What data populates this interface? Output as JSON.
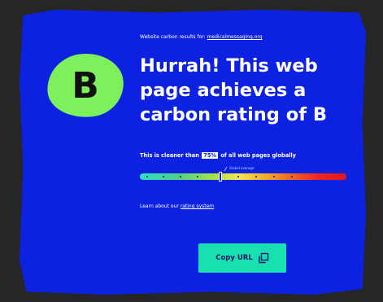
{
  "results_line": {
    "prefix": "Website carbon results for:",
    "site": "medicalmessaging.org"
  },
  "rating": {
    "letter": "B",
    "badge_color": "#7ef05c"
  },
  "headline": "Hurrah! This web page achieves a carbon rating of B",
  "cleaner": {
    "prefix": "This is cleaner than",
    "percent": "75%",
    "suffix": "of all web pages globally"
  },
  "scale": {
    "average_label": "Global average",
    "marker_position_fraction": 0.39
  },
  "learn": {
    "prefix": "Learn about our",
    "link": "rating system"
  },
  "copy_button": {
    "label": "Copy URL",
    "icon": "copy-icon"
  },
  "colors": {
    "background": "#262626",
    "card": "#0d22e0",
    "button": "#18e0b0"
  }
}
